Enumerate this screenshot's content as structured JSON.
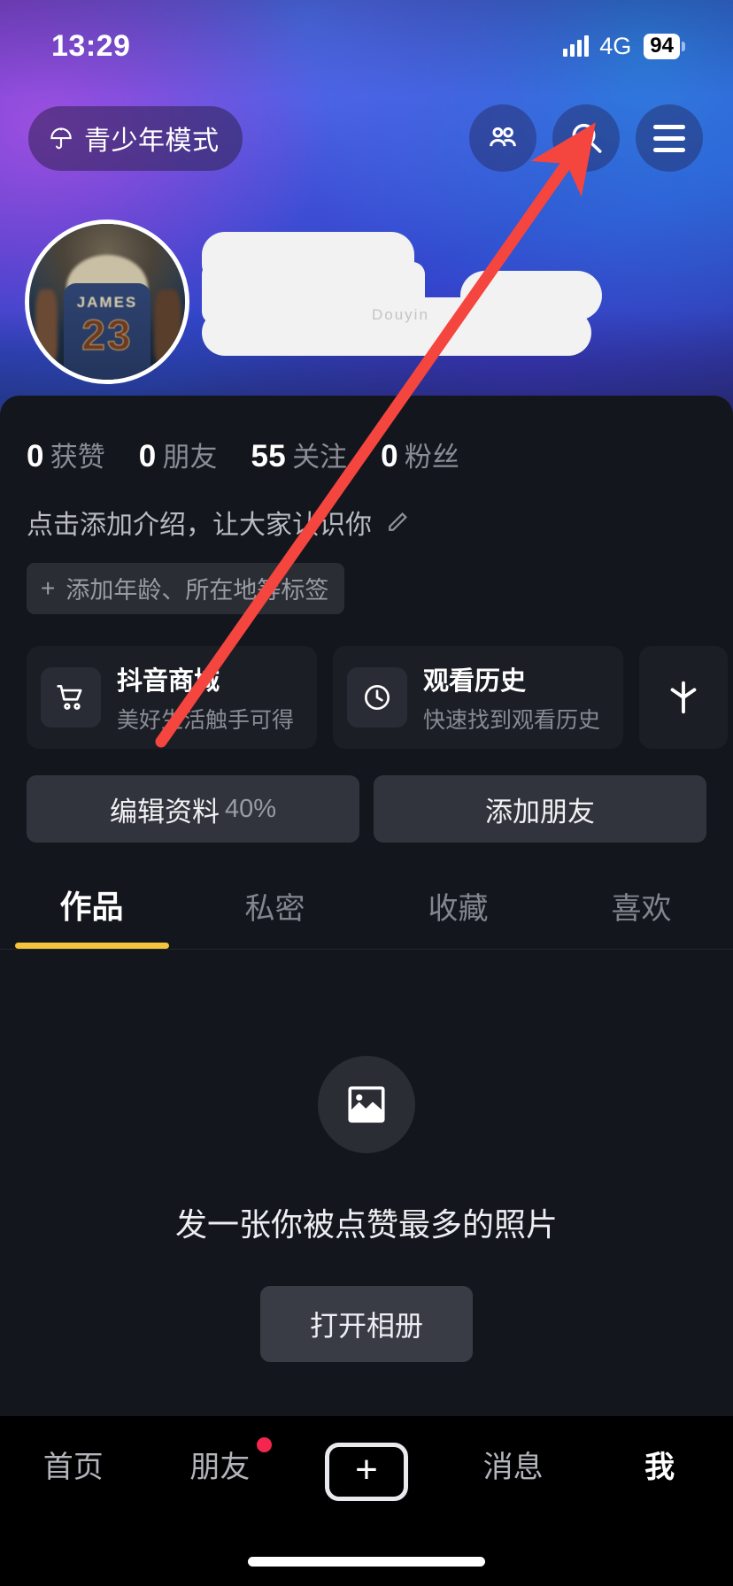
{
  "status_bar": {
    "time": "13:29",
    "network": "4G",
    "battery": "94",
    "signal_icon": "signal-bars-icon",
    "battery_icon": "battery-icon"
  },
  "top_bar": {
    "teen_mode_label": "青少年模式",
    "teen_mode_icon": "umbrella-icon",
    "friends_icon": "friends-icon",
    "search_icon": "search-icon",
    "menu_icon": "hamburger-menu-icon"
  },
  "profile": {
    "avatar_icon": "avatar",
    "avatar_jersey_name": "JAMES",
    "avatar_jersey_number": "23",
    "watermark": "Douyin"
  },
  "stats": [
    {
      "num": "0",
      "label": "获赞"
    },
    {
      "num": "0",
      "label": "朋友"
    },
    {
      "num": "55",
      "label": "关注"
    },
    {
      "num": "0",
      "label": "粉丝"
    }
  ],
  "bio": {
    "text": "点击添加介绍，让大家认识你",
    "edit_icon": "pencil-icon",
    "tag_plus": "+",
    "tag_label": "添加年龄、所在地等标签"
  },
  "services": [
    {
      "title": "抖音商城",
      "subtitle": "美好生活触手可得",
      "icon": "shopping-cart-icon"
    },
    {
      "title": "观看历史",
      "subtitle": "快速找到观看历史",
      "icon": "clock-icon"
    },
    {
      "title": "",
      "subtitle": "",
      "icon": "douyin-spark-icon"
    }
  ],
  "actions": {
    "edit_profile_label": "编辑资料",
    "edit_profile_percent": "40%",
    "add_friend_label": "添加朋友"
  },
  "tabs": [
    {
      "label": "作品",
      "active": true
    },
    {
      "label": "私密",
      "active": false
    },
    {
      "label": "收藏",
      "active": false
    },
    {
      "label": "喜欢",
      "active": false
    }
  ],
  "empty_state": {
    "icon": "image-placeholder-icon",
    "message": "发一张你被点赞最多的照片",
    "button_label": "打开相册"
  },
  "bottom_nav": [
    {
      "label": "首页",
      "active": false,
      "badge": false
    },
    {
      "label": "朋友",
      "active": false,
      "badge": true
    },
    {
      "label": "",
      "active": false,
      "badge": false,
      "icon": "plus-create-icon"
    },
    {
      "label": "消息",
      "active": false,
      "badge": false
    },
    {
      "label": "我",
      "active": true,
      "badge": false
    }
  ],
  "annotation": {
    "type": "arrow",
    "color": "#f5453f",
    "points_to": "hamburger-menu-icon"
  },
  "colors": {
    "accent_yellow": "#f3c43c",
    "badge_red": "#f5264e",
    "annotation_red": "#f5453f",
    "sheet_bg": "#14161d",
    "card_bg": "#1c1e26",
    "button_bg": "#32343d"
  }
}
